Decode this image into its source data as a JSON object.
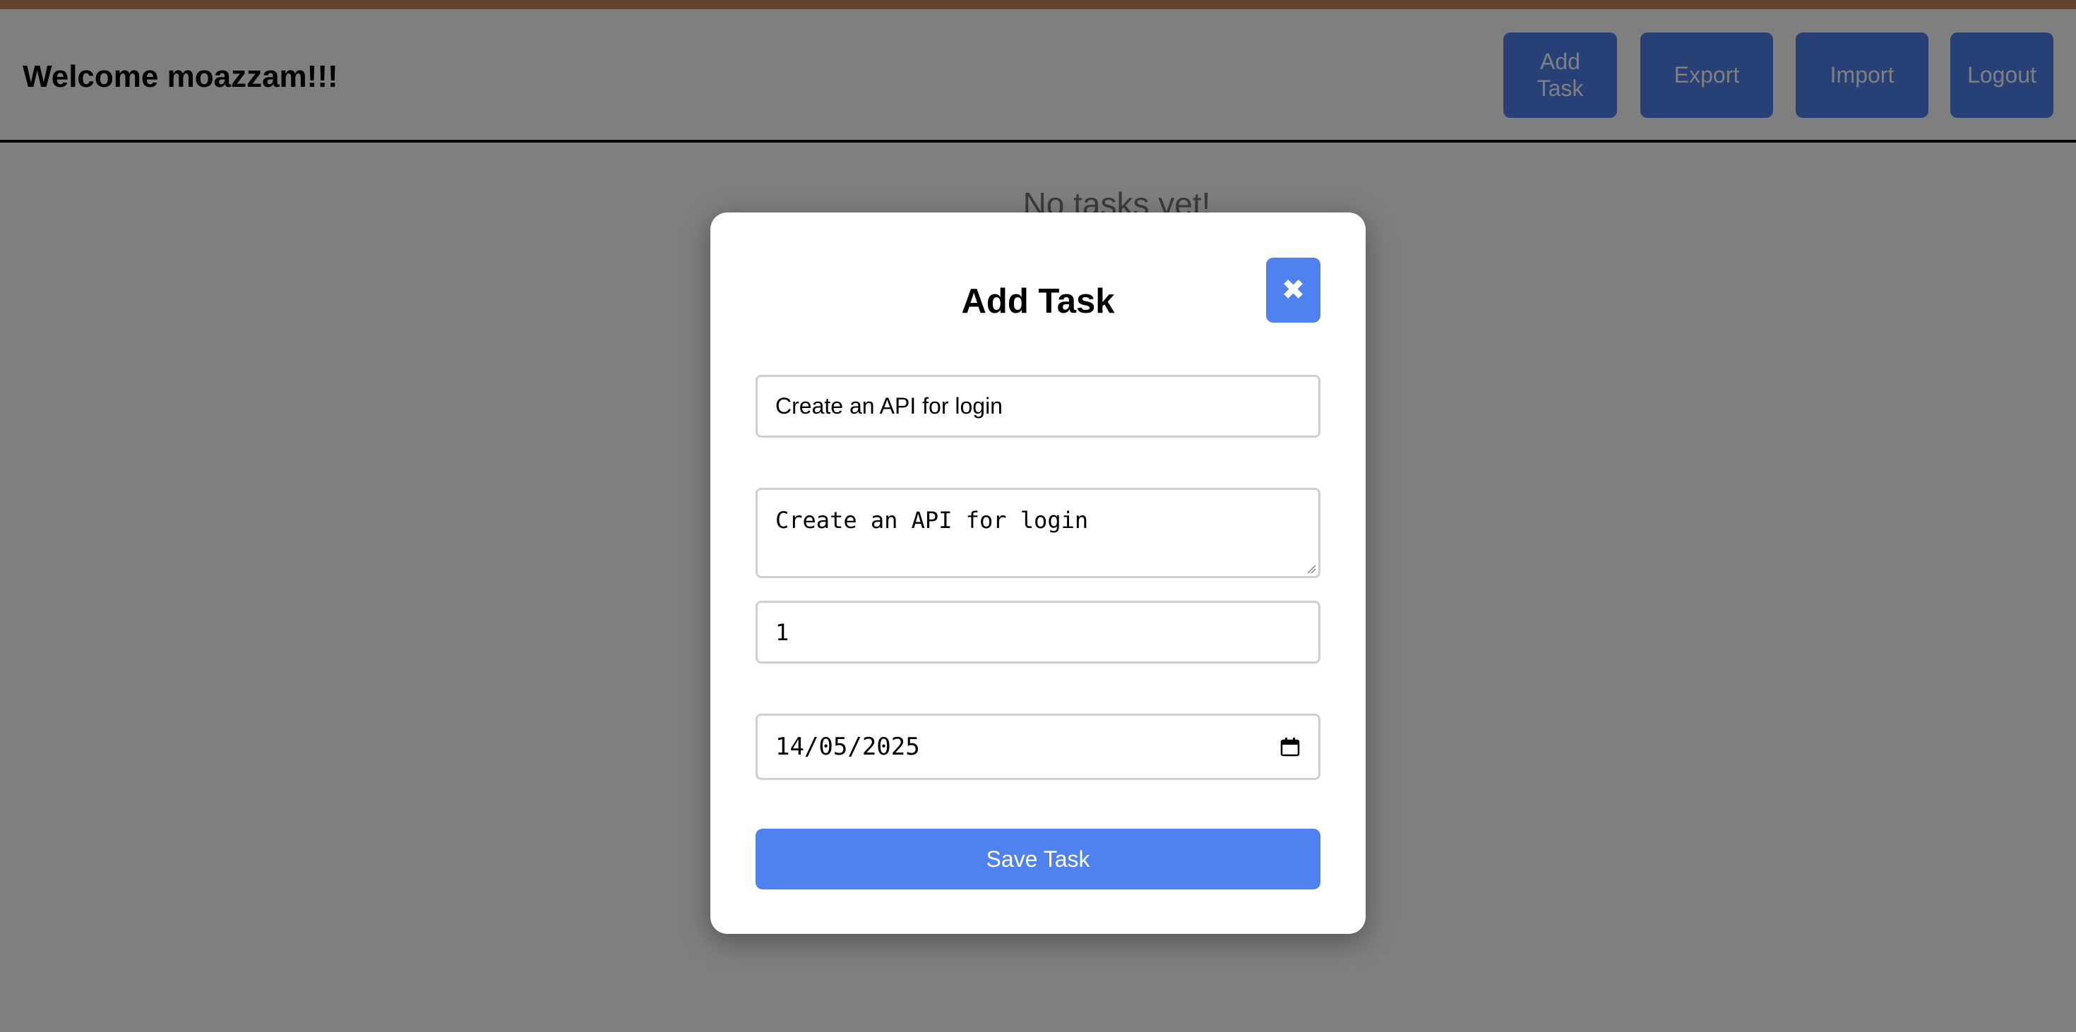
{
  "header": {
    "welcome": "Welcome moazzam!!!",
    "buttons": {
      "add_task": "Add\nTask",
      "export": "Export",
      "import": "Import",
      "logout": "Logout"
    }
  },
  "main": {
    "empty_message": "No tasks yet!"
  },
  "modal": {
    "title": "Add Task",
    "close_icon": "close-icon",
    "close_glyph": "✖",
    "fields": {
      "title_value": "Create an API for login",
      "description_value": "Create an API for login",
      "priority_value": "1",
      "due_date_value": "14/05/2025"
    },
    "save_label": "Save Task"
  },
  "colors": {
    "accent": "#4f82ee",
    "overlay": "rgba(0,0,0,0.5)",
    "top_strip": "#c4855a"
  }
}
